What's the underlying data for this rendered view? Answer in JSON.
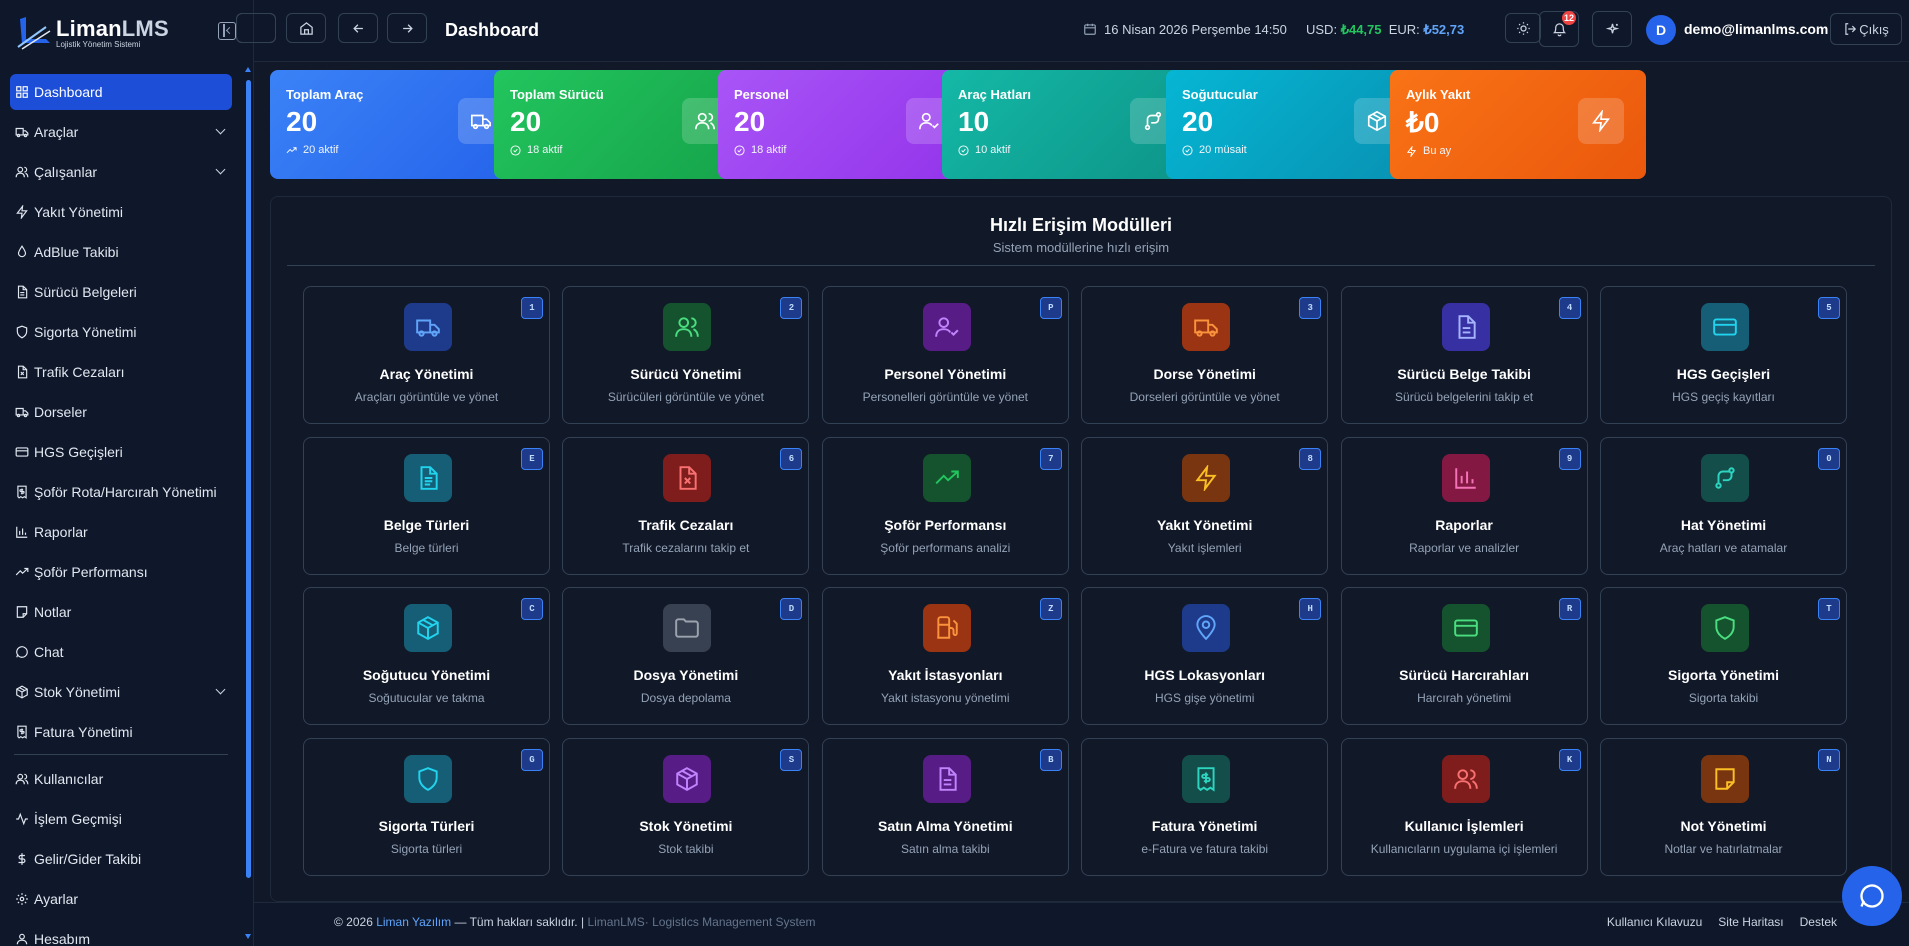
{
  "app": {
    "logo_name": "Liman",
    "logo_suffix": "LMS",
    "logo_subtitle": "Lojistik Yönetim Sistemi"
  },
  "sidebar": {
    "items": [
      {
        "label": "Dashboard",
        "icon": "grid-icon",
        "active": true
      },
      {
        "label": "Araçlar",
        "icon": "truck-icon",
        "expandable": true
      },
      {
        "label": "Çalışanlar",
        "icon": "users-icon",
        "expandable": true
      },
      {
        "label": "Yakıt Yönetimi",
        "icon": "zap-icon"
      },
      {
        "label": "AdBlue Takibi",
        "icon": "droplet-icon"
      },
      {
        "label": "Sürücü Belgeleri",
        "icon": "file-icon"
      },
      {
        "label": "Sigorta Yönetimi",
        "icon": "shield-icon"
      },
      {
        "label": "Trafik Cezaları",
        "icon": "file-x-icon"
      },
      {
        "label": "Dorseler",
        "icon": "truck-icon"
      },
      {
        "label": "HGS Geçişleri",
        "icon": "card-icon"
      },
      {
        "label": "Şoför Rota/Harcırah Yönetimi",
        "icon": "receipt-icon"
      },
      {
        "label": "Raporlar",
        "icon": "bar-chart-icon"
      },
      {
        "label": "Şoför Performansı",
        "icon": "trending-up-icon"
      },
      {
        "label": "Notlar",
        "icon": "note-icon"
      },
      {
        "label": "Chat",
        "icon": "message-icon"
      },
      {
        "label": "Stok Yönetimi",
        "icon": "package-icon",
        "expandable": true
      },
      {
        "label": "Fatura Yönetimi",
        "icon": "receipt-icon"
      },
      {
        "label": "Kullanıcılar",
        "icon": "users-icon"
      },
      {
        "label": "İşlem Geçmişi",
        "icon": "activity-icon"
      },
      {
        "label": "Gelir/Gider Takibi",
        "icon": "dollar-icon"
      },
      {
        "label": "Ayarlar",
        "icon": "gear-icon"
      },
      {
        "label": "Hesabım",
        "icon": "user-icon"
      }
    ]
  },
  "header": {
    "title": "Dashboard",
    "datetime": "16 Nisan 2026 Perşembe 14:50",
    "usd_label": "USD:",
    "usd_value": "₺44,75",
    "eur_label": "EUR:",
    "eur_value": "₺52,73",
    "notification_count": "12",
    "avatar_initial": "D",
    "user_email": "demo@limanlms.com",
    "logout_label": "Çıkış"
  },
  "stats": [
    {
      "title": "Toplam Araç",
      "value": "20",
      "sub": "20 aktif",
      "color": "#3b82f6",
      "color2": "#2563eb",
      "icon": "truck-icon",
      "sub_icon": "trending-up-icon"
    },
    {
      "title": "Toplam Sürücü",
      "value": "20",
      "sub": "18 aktif",
      "color": "#22c55e",
      "color2": "#16a34a",
      "icon": "users-icon",
      "sub_icon": "check-circle-icon"
    },
    {
      "title": "Personel",
      "value": "20",
      "sub": "18 aktif",
      "color": "#a855f7",
      "color2": "#9333ea",
      "icon": "user-check-icon",
      "sub_icon": "check-circle-icon"
    },
    {
      "title": "Araç Hatları",
      "value": "10",
      "sub": "10 aktif",
      "color": "#14b8a6",
      "color2": "#0d9488",
      "icon": "route-icon",
      "sub_icon": "check-circle-icon"
    },
    {
      "title": "Soğutucular",
      "value": "20",
      "sub": "20 müsait",
      "color": "#06b6d4",
      "color2": "#0891b2",
      "icon": "package-icon",
      "sub_icon": "check-circle-icon"
    },
    {
      "title": "Aylık Yakıt",
      "value": "₺0",
      "sub": "Bu ay",
      "color": "#f97316",
      "color2": "#ea580c",
      "icon": "zap-icon",
      "sub_icon": "zap-icon"
    }
  ],
  "modules": {
    "title": "Hızlı Erişim Modülleri",
    "subtitle": "Sistem modüllerine hızlı erişim",
    "items": [
      {
        "title": "Araç Yönetimi",
        "desc": "Araçları görüntüle ve yönet",
        "key": "1",
        "icon": "truck-icon",
        "bg": "#1e3a8a",
        "fg": "#60a5fa"
      },
      {
        "title": "Sürücü Yönetimi",
        "desc": "Sürücüleri görüntüle ve yönet",
        "key": "2",
        "icon": "users-icon",
        "bg": "#14532d",
        "fg": "#4ade80"
      },
      {
        "title": "Personel Yönetimi",
        "desc": "Personelleri görüntüle ve yönet",
        "key": "P",
        "icon": "user-check-icon",
        "bg": "#581c87",
        "fg": "#c084fc"
      },
      {
        "title": "Dorse Yönetimi",
        "desc": "Dorseleri görüntüle ve yönet",
        "key": "3",
        "icon": "truck-icon",
        "bg": "#9a3412",
        "fg": "#fb923c"
      },
      {
        "title": "Sürücü Belge Takibi",
        "desc": "Sürücü belgelerini takip et",
        "key": "4",
        "icon": "file-icon",
        "bg": "#3730a3",
        "fg": "#a5b4fc"
      },
      {
        "title": "HGS Geçişleri",
        "desc": "HGS geçiş kayıtları",
        "key": "5",
        "icon": "card-icon",
        "bg": "#155e75",
        "fg": "#22d3ee"
      },
      {
        "title": "Belge Türleri",
        "desc": "Belge türleri",
        "key": "E",
        "icon": "file-text-icon",
        "bg": "#155e75",
        "fg": "#22d3ee"
      },
      {
        "title": "Trafik Cezaları",
        "desc": "Trafik cezalarını takip et",
        "key": "6",
        "icon": "file-x-icon",
        "bg": "#7f1d1d",
        "fg": "#f87171"
      },
      {
        "title": "Şoför Performansı",
        "desc": "Şoför performans analizi",
        "key": "7",
        "icon": "trending-up-icon",
        "bg": "#14532d",
        "fg": "#22c55e"
      },
      {
        "title": "Yakıt Yönetimi",
        "desc": "Yakıt işlemleri",
        "key": "8",
        "icon": "zap-icon",
        "bg": "#78350f",
        "fg": "#fbbf24"
      },
      {
        "title": "Raporlar",
        "desc": "Raporlar ve analizler",
        "key": "9",
        "icon": "bar-chart-icon",
        "bg": "#831843",
        "fg": "#f472b6"
      },
      {
        "title": "Hat Yönetimi",
        "desc": "Araç hatları ve atamalar",
        "key": "0",
        "icon": "route-icon",
        "bg": "#134e4a",
        "fg": "#2dd4bf"
      },
      {
        "title": "Soğutucu Yönetimi",
        "desc": "Soğutucular ve takma",
        "key": "C",
        "icon": "package-icon",
        "bg": "#155e75",
        "fg": "#22d3ee"
      },
      {
        "title": "Dosya Yönetimi",
        "desc": "Dosya depolama",
        "key": "D",
        "icon": "folder-icon",
        "bg": "#374151",
        "fg": "#9ca3af"
      },
      {
        "title": "Yakıt İstasyonları",
        "desc": "Yakıt istasyonu yönetimi",
        "key": "Z",
        "icon": "fuel-icon",
        "bg": "#9a3412",
        "fg": "#fb923c"
      },
      {
        "title": "HGS Lokasyonları",
        "desc": "HGS gişe yönetimi",
        "key": "H",
        "icon": "map-pin-icon",
        "bg": "#1e3a8a",
        "fg": "#60a5fa"
      },
      {
        "title": "Sürücü Harcırahları",
        "desc": "Harcırah yönetimi",
        "key": "R",
        "icon": "card-icon",
        "bg": "#14532d",
        "fg": "#4ade80"
      },
      {
        "title": "Sigorta Yönetimi",
        "desc": "Sigorta takibi",
        "key": "T",
        "icon": "shield-icon",
        "bg": "#14532d",
        "fg": "#4ade80"
      },
      {
        "title": "Sigorta Türleri",
        "desc": "Sigorta türleri",
        "key": "G",
        "icon": "shield-icon",
        "bg": "#155e75",
        "fg": "#22d3ee"
      },
      {
        "title": "Stok Yönetimi",
        "desc": "Stok takibi",
        "key": "S",
        "icon": "package-icon",
        "bg": "#581c87",
        "fg": "#c084fc"
      },
      {
        "title": "Satın Alma Yönetimi",
        "desc": "Satın alma takibi",
        "key": "B",
        "icon": "file-icon",
        "bg": "#581c87",
        "fg": "#c084fc"
      },
      {
        "title": "Fatura Yönetimi",
        "desc": "e-Fatura ve fatura takibi",
        "key": "",
        "icon": "receipt-icon",
        "bg": "#134e4a",
        "fg": "#2dd4bf"
      },
      {
        "title": "Kullanıcı İşlemleri",
        "desc": "Kullanıcıların uygulama içi işlemleri",
        "key": "K",
        "icon": "users-icon",
        "bg": "#7f1d1d",
        "fg": "#f87171"
      },
      {
        "title": "Not Yönetimi",
        "desc": "Notlar ve hatırlatmalar",
        "key": "N",
        "icon": "note-icon",
        "bg": "#78350f",
        "fg": "#fbbf24"
      }
    ]
  },
  "footer": {
    "copyright": "© 2026",
    "brand": "Liman Yazılım",
    "rights": "— Tüm hakları saklıdır. |",
    "product": "LimanLMS",
    "product_desc": "· Logistics Management System",
    "links": [
      "Kullanıcı Kılavuzu",
      "Site Haritası",
      "Destek"
    ]
  }
}
